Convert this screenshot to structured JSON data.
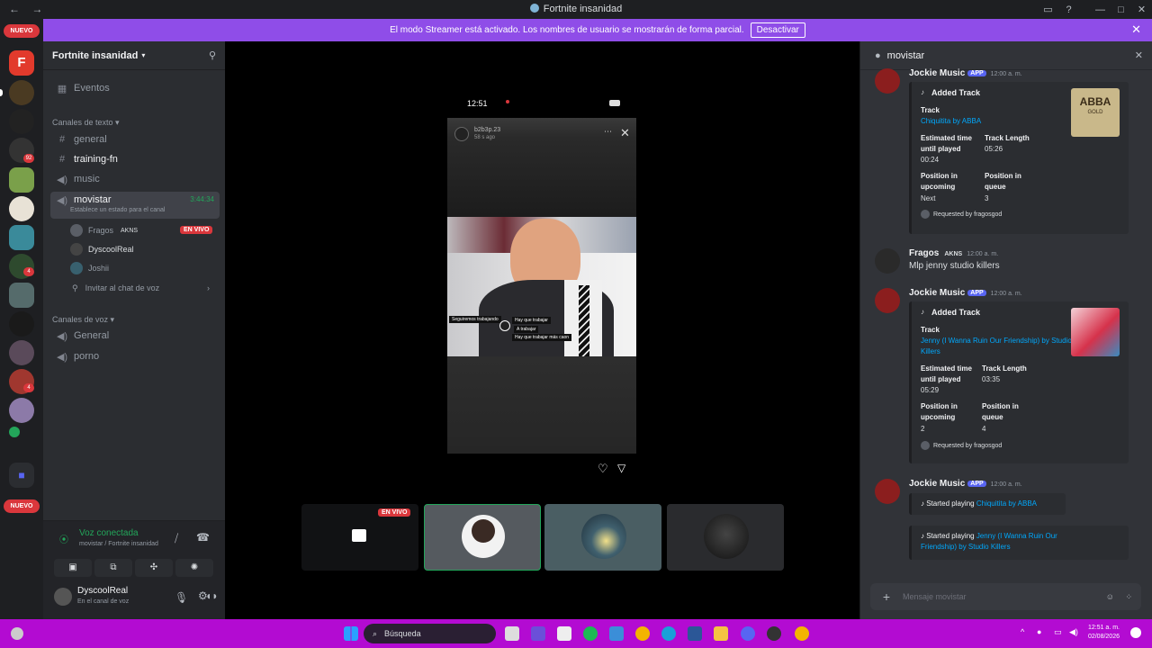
{
  "window": {
    "title": "Fortnite insanidad",
    "nav_back": "←",
    "nav_forward": "→"
  },
  "servers": {
    "nuevo_top": "NUEVO",
    "nuevo_bottom": "NUEVO",
    "badge_92": "92",
    "badge_4a": "4",
    "badge_4b": "4"
  },
  "banner": {
    "text": "El modo Streamer está activado. Los nombres de usuario se mostrarán de forma parcial.",
    "button": "Desactivar"
  },
  "guild": {
    "name": "Fortnite insanidad"
  },
  "channels": {
    "events": "Eventos",
    "text_category": "Canales de texto",
    "text": [
      "general",
      "training-fn",
      "music"
    ],
    "voice_channel": {
      "name": "movistar",
      "timer": "3:44:34",
      "status": "Establece un estado para el canal"
    },
    "voice_users": [
      {
        "name": "Fragos",
        "tag": "AKNS",
        "live": "EN VIVO"
      },
      {
        "name": "DyscoolReal"
      },
      {
        "name": "Joshii"
      }
    ],
    "invite": "Invitar al chat de voz",
    "voice_category": "Canales de voz",
    "voice": [
      "General",
      "porno"
    ]
  },
  "voice_panel": {
    "title": "Voz conectada",
    "subtitle": "movistar / Fortnite insanidad"
  },
  "user_panel": {
    "name": "DyscoolReal",
    "status": "En el canal de voz"
  },
  "stage": {
    "status_time": "12:51",
    "story_user": "b2b3p.23",
    "story_ago": "58 s ago",
    "caption_left": "Seguiremos trabajando",
    "caption_r1": "Hay que trabajar",
    "caption_r2": "A trabajar",
    "caption_r3": "Hay que trabajar más caon",
    "live": "EN VIVO"
  },
  "panel": {
    "channel": "movistar",
    "messages": [
      {
        "author": "Jockie Music",
        "app": "APP",
        "time": "12:00 a. m.",
        "embed": {
          "title": "Added Track",
          "track_label": "Track",
          "track": "Chiquitita by ABBA",
          "eta_label": "Estimated time until played",
          "eta": "00:24",
          "len_label": "Track Length",
          "len": "05:26",
          "pos_up_label": "Position in upcoming",
          "pos_up": "Next",
          "pos_q_label": "Position in queue",
          "pos_q": "3",
          "requested": "Requested by fragosgod",
          "thumb_title": "ABBA",
          "thumb_sub": "GOLD"
        }
      },
      {
        "author": "Fragos",
        "tag": "AKNS",
        "time": "12:00 a. m.",
        "text": "Mlp jenny studio killers"
      },
      {
        "author": "Jockie Music",
        "app": "APP",
        "time": "12:00 a. m.",
        "embed": {
          "title": "Added Track",
          "track_label": "Track",
          "track": "Jenny (I Wanna Ruin Our Friendship) by Studio Killers",
          "eta_label": "Estimated time until played",
          "eta": "05:29",
          "len_label": "Track Length",
          "len": "03:35",
          "pos_up_label": "Position in upcoming",
          "pos_up": "2",
          "pos_q_label": "Position in queue",
          "pos_q": "4",
          "requested": "Requested by fragosgod"
        }
      },
      {
        "author": "Jockie Music",
        "app": "APP",
        "time": "12:00 a. m.",
        "started1_prefix": "Started playing",
        "started1": "Chiquitita by ABBA",
        "started2_prefix": "Started playing",
        "started2": "Jenny (I Wanna Ruin Our Friendship) by Studio Killers"
      }
    ],
    "input_placeholder": "Mensaje movistar"
  },
  "taskbar": {
    "search": "Búsqueda",
    "time": "12:51 a. m.",
    "date": "02/08/2026"
  },
  "colors": {
    "banner": "#8f4de8",
    "taskbar": "#b30bd2",
    "link": "#00a8fc",
    "live": "#da373c",
    "app_tag": "#5865f2"
  }
}
